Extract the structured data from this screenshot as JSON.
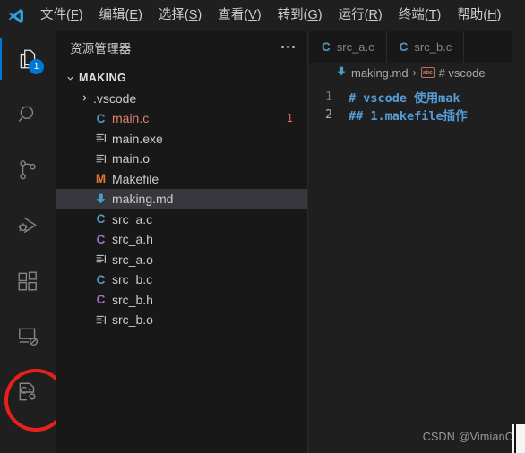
{
  "window": {
    "logo_icon": "vscode-logo-icon"
  },
  "menubar": {
    "items": [
      {
        "label": "文件",
        "mnemonic": "F"
      },
      {
        "label": "编辑",
        "mnemonic": "E"
      },
      {
        "label": "选择",
        "mnemonic": "S"
      },
      {
        "label": "查看",
        "mnemonic": "V"
      },
      {
        "label": "转到",
        "mnemonic": "G"
      },
      {
        "label": "运行",
        "mnemonic": "R"
      },
      {
        "label": "终端",
        "mnemonic": "T"
      },
      {
        "label": "帮助",
        "mnemonic": "H"
      }
    ]
  },
  "activity_bar": {
    "items": [
      {
        "name": "explorer-icon",
        "badge": "1",
        "active": true
      },
      {
        "name": "search-icon",
        "badge": "",
        "active": false
      },
      {
        "name": "source-control-icon",
        "badge": "",
        "active": false
      },
      {
        "name": "run-and-debug-icon",
        "badge": "",
        "active": false
      },
      {
        "name": "extensions-icon",
        "badge": "",
        "active": false
      },
      {
        "name": "remote-explorer-icon",
        "badge": "",
        "active": false
      },
      {
        "name": "cpp-config-icon",
        "badge": "",
        "active": false
      }
    ],
    "annotation_color": "#e8201b"
  },
  "sidebar": {
    "title": "资源管理器",
    "more_actions": "more-actions-icon",
    "root_folder": "MAKING",
    "tree": [
      {
        "label": ".vscode",
        "type": "folder",
        "icon": "chevron-right-icon",
        "indent": 1,
        "selected": false,
        "modified": false,
        "count": ""
      },
      {
        "label": "main.c",
        "type": "file",
        "icon": "c-source-icon",
        "indent": 1,
        "selected": false,
        "modified": true,
        "count": "1"
      },
      {
        "label": "main.exe",
        "type": "file",
        "icon": "binary-file-icon",
        "indent": 1,
        "selected": false,
        "modified": false,
        "count": ""
      },
      {
        "label": "main.o",
        "type": "file",
        "icon": "binary-file-icon",
        "indent": 1,
        "selected": false,
        "modified": false,
        "count": ""
      },
      {
        "label": "Makefile",
        "type": "file",
        "icon": "makefile-icon",
        "indent": 1,
        "selected": false,
        "modified": false,
        "count": ""
      },
      {
        "label": "making.md",
        "type": "file",
        "icon": "markdown-icon",
        "indent": 1,
        "selected": true,
        "modified": false,
        "count": ""
      },
      {
        "label": "src_a.c",
        "type": "file",
        "icon": "c-source-icon",
        "indent": 1,
        "selected": false,
        "modified": false,
        "count": ""
      },
      {
        "label": "src_a.h",
        "type": "file",
        "icon": "c-header-icon",
        "indent": 1,
        "selected": false,
        "modified": false,
        "count": ""
      },
      {
        "label": "src_a.o",
        "type": "file",
        "icon": "binary-file-icon",
        "indent": 1,
        "selected": false,
        "modified": false,
        "count": ""
      },
      {
        "label": "src_b.c",
        "type": "file",
        "icon": "c-source-icon",
        "indent": 1,
        "selected": false,
        "modified": false,
        "count": ""
      },
      {
        "label": "src_b.h",
        "type": "file",
        "icon": "c-header-icon",
        "indent": 1,
        "selected": false,
        "modified": false,
        "count": ""
      },
      {
        "label": "src_b.o",
        "type": "file",
        "icon": "binary-file-icon",
        "indent": 1,
        "selected": false,
        "modified": false,
        "count": ""
      }
    ]
  },
  "editor": {
    "tabs": [
      {
        "label": "src_a.c",
        "icon": "c-source-icon",
        "active": false
      },
      {
        "label": "src_b.c",
        "icon": "c-source-icon",
        "active": false
      }
    ],
    "breadcrumb": {
      "file": "making.md",
      "file_icon": "markdown-icon",
      "separator": "›",
      "symbol_icon": "abc-symbol-icon",
      "symbol": "# vscode"
    },
    "lines": [
      {
        "number": "1",
        "text": "# vscode 使用mak",
        "active": false
      },
      {
        "number": "2",
        "text": "## 1.makefile插作",
        "active": true
      }
    ]
  },
  "watermark": "CSDN @VimianC"
}
